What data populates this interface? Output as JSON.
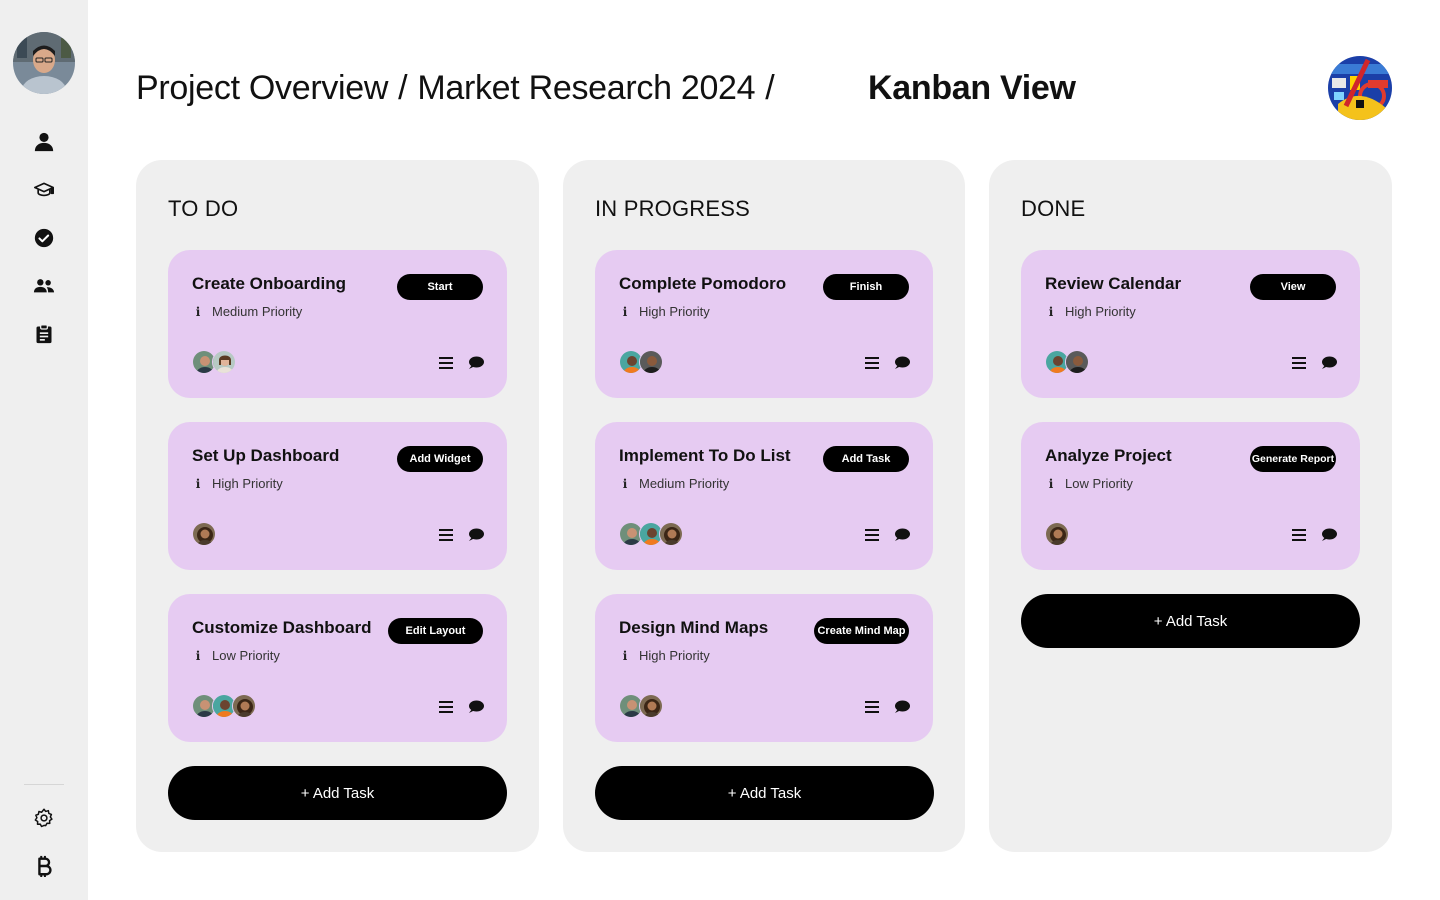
{
  "header": {
    "breadcrumbs": [
      "Project Overview",
      "Market Research 2024"
    ],
    "separator": "/",
    "current": "Kanban View"
  },
  "sidebar": {
    "icons": [
      "user-icon",
      "graduation-cap-icon",
      "check-circle-icon",
      "users-icon",
      "clipboard-icon"
    ],
    "bottom_icons": [
      "gear-icon",
      "bitcoin-icon"
    ]
  },
  "colors": {
    "card": "#e6cbf2",
    "column": "#efefef",
    "button": "#000000",
    "sidebar": "#efefef"
  },
  "columns": [
    {
      "title": "TO DO",
      "cards": [
        {
          "title": "Create Onboarding",
          "button": "Start",
          "priority": "Medium Priority",
          "avatars": 2
        },
        {
          "title": "Set Up Dashboard",
          "button": "Add Widget",
          "priority": "High Priority",
          "avatars": 1
        },
        {
          "title": "Customize Dashboard",
          "button": "Edit Layout",
          "priority": "Low Priority",
          "avatars": 3
        }
      ],
      "add_label": "+ Add Task"
    },
    {
      "title": "IN PROGRESS",
      "cards": [
        {
          "title": "Complete Pomodoro",
          "button": "Finish",
          "priority": "High Priority",
          "avatars": 2
        },
        {
          "title": "Implement To Do List",
          "button": "Add Task",
          "priority": "Medium Priority",
          "avatars": 3
        },
        {
          "title": "Design Mind Maps",
          "button": "Create Mind Map",
          "priority": "High Priority",
          "avatars": 2
        }
      ],
      "add_label": "+ Add Task"
    },
    {
      "title": "DONE",
      "cards": [
        {
          "title": "Review Calendar",
          "button": "View",
          "priority": "High Priority",
          "avatars": 2
        },
        {
          "title": "Analyze Project",
          "button": "Generate Report",
          "priority": "Low Priority",
          "avatars": 1
        }
      ],
      "add_label": "+ Add Task"
    }
  ]
}
